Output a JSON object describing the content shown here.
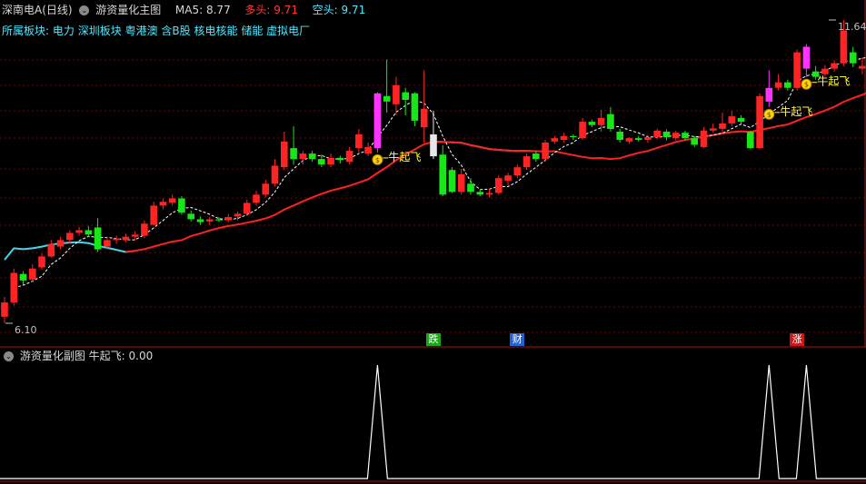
{
  "header": {
    "stock_name": "深南电A(日线)",
    "indicator_main": "游资量化主图",
    "ma5_label": "MA5:",
    "ma5_value": "8.77",
    "long_label": "多头:",
    "long_value": "9.71",
    "short_label": "空头:",
    "short_value": "9.71",
    "sector_label": "所属板块:",
    "sectors": [
      "电力",
      "深圳板块",
      "粤港澳",
      "含B股",
      "核电核能",
      "储能",
      "虚拟电厂"
    ]
  },
  "sub_header": {
    "indicator_sub": "游资量化副图",
    "signal_label": "牛起飞:",
    "signal_value": "0.00"
  },
  "price_labels": {
    "low": "6.10",
    "high": "11.64"
  },
  "signal_text": "牛起飞",
  "events": [
    {
      "label": "跌",
      "index": 46,
      "color": "#18a818"
    },
    {
      "label": "财",
      "index": 55,
      "color": "#1e63d8"
    },
    {
      "label": "涨",
      "index": 85,
      "color": "#c81818"
    }
  ],
  "colors": {
    "up": "#ff2424",
    "down": "#19e619",
    "signal_bar": "#ff33ff",
    "neutral_bar": "#e8e8e8",
    "ma_red": "#ff2020",
    "ma_cyan": "#42d7f0",
    "ma_white": "#ffffff",
    "grid": "#7a0000",
    "text_yellow": "#ffff33"
  },
  "chart_data": {
    "type": "candlestick",
    "price_range": [
      6.1,
      11.64
    ],
    "candles": [
      [
        6.22,
        6.48,
        6.1,
        6.58
      ],
      [
        6.48,
        7.02,
        6.42,
        7.1
      ],
      [
        7.0,
        6.88,
        6.78,
        7.05
      ],
      [
        6.9,
        7.1,
        6.85,
        7.18
      ],
      [
        7.12,
        7.32,
        7.08,
        7.38
      ],
      [
        7.32,
        7.55,
        7.3,
        7.62
      ],
      [
        7.5,
        7.62,
        7.45,
        7.68
      ],
      [
        7.62,
        7.75,
        7.55,
        7.8
      ],
      [
        7.75,
        7.8,
        7.7,
        7.86
      ],
      [
        7.8,
        7.72,
        7.68,
        7.88
      ],
      [
        7.85,
        7.45,
        7.4,
        8.02
      ],
      [
        7.5,
        7.62,
        7.45,
        7.68
      ],
      [
        7.62,
        7.65,
        7.55,
        7.7
      ],
      [
        7.62,
        7.68,
        7.58,
        7.74
      ],
      [
        7.68,
        7.72,
        7.62,
        7.78
      ],
      [
        7.7,
        7.92,
        7.66,
        7.98
      ],
      [
        7.9,
        8.25,
        7.88,
        8.32
      ],
      [
        8.25,
        8.32,
        8.18,
        8.38
      ],
      [
        8.3,
        8.38,
        8.25,
        8.45
      ],
      [
        8.38,
        8.12,
        8.08,
        8.42
      ],
      [
        8.1,
        8.0,
        7.96,
        8.16
      ],
      [
        8.0,
        7.95,
        7.9,
        8.05
      ],
      [
        7.96,
        8.0,
        7.9,
        8.05
      ],
      [
        8.0,
        7.98,
        7.95,
        8.04
      ],
      [
        7.98,
        8.04,
        7.94,
        8.1
      ],
      [
        8.05,
        8.1,
        7.98,
        8.14
      ],
      [
        8.1,
        8.3,
        8.06,
        8.36
      ],
      [
        8.3,
        8.45,
        8.25,
        8.52
      ],
      [
        8.45,
        8.65,
        8.4,
        8.72
      ],
      [
        8.65,
        8.98,
        8.6,
        9.1
      ],
      [
        8.95,
        9.42,
        8.9,
        9.6
      ],
      [
        9.3,
        9.1,
        9.0,
        9.7
      ],
      [
        9.1,
        9.2,
        9.0,
        9.25
      ],
      [
        9.2,
        9.1,
        9.05,
        9.25
      ],
      [
        9.1,
        9.0,
        8.95,
        9.18
      ],
      [
        9.0,
        9.12,
        8.95,
        9.2
      ],
      [
        9.12,
        9.08,
        9.02,
        9.16
      ],
      [
        9.05,
        9.25,
        9.0,
        9.32
      ],
      [
        9.3,
        9.55,
        9.22,
        9.65
      ],
      [
        9.2,
        9.32,
        9.15,
        9.4
      ],
      [
        9.3,
        10.3,
        9.22,
        10.32
      ],
      [
        10.25,
        10.15,
        9.95,
        10.92
      ],
      [
        10.1,
        10.45,
        9.9,
        10.6
      ],
      [
        10.32,
        10.18,
        9.9,
        10.4
      ],
      [
        10.3,
        9.8,
        9.7,
        10.32
      ],
      [
        9.68,
        10.02,
        9.4,
        10.72
      ],
      [
        9.55,
        9.15,
        9.1,
        9.98
      ],
      [
        9.18,
        8.45,
        8.42,
        9.35
      ],
      [
        8.9,
        8.5,
        8.48,
        8.95
      ],
      [
        8.5,
        8.82,
        8.45,
        8.92
      ],
      [
        8.65,
        8.5,
        8.45,
        8.75
      ],
      [
        8.5,
        8.45,
        8.42,
        8.55
      ],
      [
        8.45,
        8.48,
        8.4,
        8.55
      ],
      [
        8.48,
        8.75,
        8.45,
        8.8
      ],
      [
        8.7,
        8.8,
        8.62,
        8.85
      ],
      [
        8.8,
        8.95,
        8.75,
        9.0
      ],
      [
        8.95,
        9.15,
        8.9,
        9.2
      ],
      [
        9.2,
        9.1,
        9.05,
        9.25
      ],
      [
        9.1,
        9.4,
        9.05,
        9.45
      ],
      [
        9.42,
        9.48,
        9.38,
        9.52
      ],
      [
        9.45,
        9.52,
        9.4,
        9.58
      ],
      [
        9.52,
        9.5,
        9.45,
        9.55
      ],
      [
        9.48,
        9.78,
        9.45,
        9.85
      ],
      [
        9.78,
        9.72,
        9.68,
        9.82
      ],
      [
        9.72,
        9.85,
        9.6,
        10.0
      ],
      [
        9.92,
        9.65,
        9.6,
        10.05
      ],
      [
        9.6,
        9.45,
        9.4,
        9.65
      ],
      [
        9.42,
        9.48,
        9.38,
        9.5
      ],
      [
        9.48,
        9.45,
        9.42,
        9.52
      ],
      [
        9.45,
        9.5,
        9.4,
        9.54
      ],
      [
        9.5,
        9.62,
        9.46,
        9.66
      ],
      [
        9.6,
        9.5,
        9.44,
        9.64
      ],
      [
        9.48,
        9.58,
        9.44,
        9.62
      ],
      [
        9.58,
        9.48,
        9.44,
        9.62
      ],
      [
        9.48,
        9.36,
        9.32,
        9.52
      ],
      [
        9.32,
        9.62,
        9.3,
        9.68
      ],
      [
        9.62,
        9.66,
        9.58,
        9.75
      ],
      [
        9.65,
        9.75,
        9.6,
        9.95
      ],
      [
        9.75,
        9.88,
        9.7,
        9.98
      ],
      [
        9.85,
        9.78,
        9.72,
        9.9
      ],
      [
        9.6,
        9.3,
        9.28,
        9.62
      ],
      [
        9.3,
        10.25,
        9.28,
        10.3
      ],
      [
        10.15,
        10.4,
        10.05,
        10.72
      ],
      [
        10.4,
        10.5,
        10.35,
        10.65
      ],
      [
        10.5,
        10.4,
        10.35,
        10.55
      ],
      [
        10.4,
        11.05,
        10.35,
        11.1
      ],
      [
        11.15,
        10.75,
        10.6,
        11.2
      ],
      [
        10.7,
        10.6,
        10.55,
        10.8
      ],
      [
        10.65,
        10.75,
        10.6,
        10.82
      ],
      [
        10.75,
        10.85,
        10.7,
        10.9
      ],
      [
        10.85,
        11.45,
        10.8,
        11.64
      ],
      [
        11.05,
        10.85,
        10.78,
        11.15
      ],
      [
        10.75,
        10.8,
        10.65,
        10.95
      ],
      [
        10.82,
        10.92,
        10.75,
        11.0
      ]
    ],
    "signal_indices": [
      40,
      82,
      86
    ],
    "neutral_index": 46
  }
}
